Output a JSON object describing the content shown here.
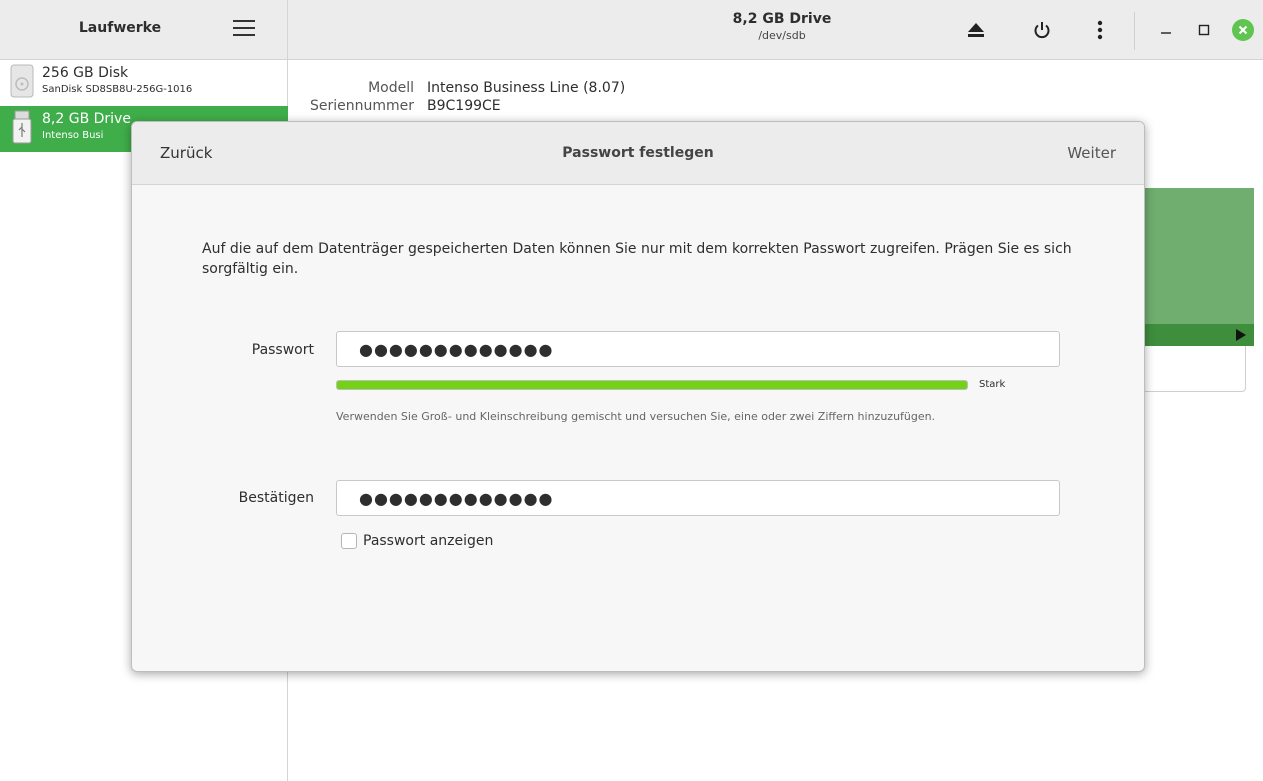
{
  "header": {
    "sidebar_title": "Laufwerke",
    "drive_title": "8,2 GB Drive",
    "drive_path": "/dev/sdb"
  },
  "icons": {
    "menu": "hamburger-menu-icon",
    "eject": "eject-icon",
    "power": "power-icon",
    "more": "vertical-dots-icon",
    "minimize": "minimize-icon",
    "maximize": "maximize-icon",
    "close": "close-icon"
  },
  "sidebar": {
    "items": [
      {
        "name": "256 GB Disk",
        "model": "SanDisk SD8SB8U-256G-1016",
        "selected": false
      },
      {
        "name": "8,2 GB Drive",
        "model": "Intenso Busi",
        "selected": true
      }
    ]
  },
  "drive_info": {
    "model_label": "Modell",
    "model_value": "Intenso Business Line (8.07)",
    "serial_label": "Seriennummer",
    "serial_value": "B9C199CE"
  },
  "dialog": {
    "back_label": "Zurück",
    "title": "Passwort festlegen",
    "next_label": "Weiter",
    "intro_text": "Auf die auf dem Datenträger gespeicherten Daten können Sie nur mit dem korrekten Passwort zugreifen. Prägen Sie es sich sorgfältig ein.",
    "password_label": "Passwort",
    "password_value": "●●●●●●●●●●●●●",
    "strength_label": "Stark",
    "strength_percent": 100,
    "hint": "Verwenden Sie Groß- und Kleinschreibung gemischt und versuchen Sie, eine oder zwei Ziffern hinzuzufügen.",
    "confirm_label": "Bestätigen",
    "confirm_value": "●●●●●●●●●●●●●",
    "show_password_label": "Passwort anzeigen",
    "show_password_checked": false
  },
  "colors": {
    "accent_green": "#3fae4a",
    "close_green": "#5fc550",
    "strength_green": "#73d216"
  }
}
